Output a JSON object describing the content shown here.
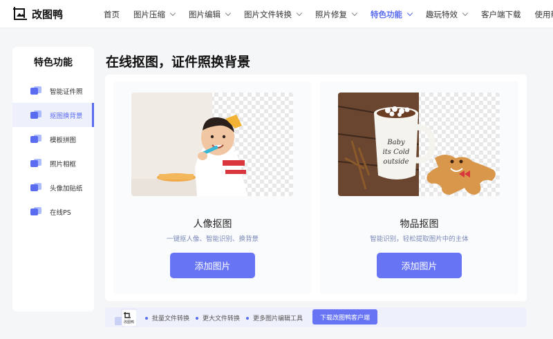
{
  "app": {
    "name": "改图鸭"
  },
  "nav": [
    {
      "label": "首页",
      "dropdown": false,
      "active": false
    },
    {
      "label": "图片压缩",
      "dropdown": true,
      "active": false
    },
    {
      "label": "图片编辑",
      "dropdown": true,
      "active": false
    },
    {
      "label": "图片文件转换",
      "dropdown": true,
      "active": false
    },
    {
      "label": "照片修复",
      "dropdown": true,
      "active": false
    },
    {
      "label": "特色功能",
      "dropdown": true,
      "active": true
    },
    {
      "label": "趣玩特效",
      "dropdown": true,
      "active": false
    },
    {
      "label": "客户端下载",
      "dropdown": false,
      "active": false
    },
    {
      "label": "使用帮助",
      "dropdown": false,
      "active": false
    }
  ],
  "sidebar": {
    "title": "特色功能",
    "items": [
      {
        "label": "智能证件照",
        "icon": "id-photo-icon",
        "active": false
      },
      {
        "label": "抠图换背景",
        "icon": "cutout-icon",
        "active": true
      },
      {
        "label": "模板拼图",
        "icon": "collage-icon",
        "active": false
      },
      {
        "label": "照片相框",
        "icon": "frame-icon",
        "active": false
      },
      {
        "label": "头像加贴纸",
        "icon": "sticker-icon",
        "active": false
      },
      {
        "label": "在线PS",
        "icon": "ps-icon",
        "active": false
      }
    ]
  },
  "main": {
    "title": "在线抠图，证件照换背景",
    "cards": [
      {
        "title": "人像抠图",
        "desc": "一键抠人像、智能识别、换背景",
        "button": "添加图片"
      },
      {
        "title": "物品抠图",
        "desc": "智能识别，轻松提取图片中的主体",
        "button": "添加图片"
      }
    ]
  },
  "footer": {
    "logo_text": "改图鸭",
    "features": [
      "批量文件转换",
      "更大文件转换",
      "更多图片编辑工具"
    ],
    "download_button": "下载改图鸭客户端"
  },
  "colors": {
    "accent": "#5a6cf0",
    "button": "#6775f5"
  }
}
